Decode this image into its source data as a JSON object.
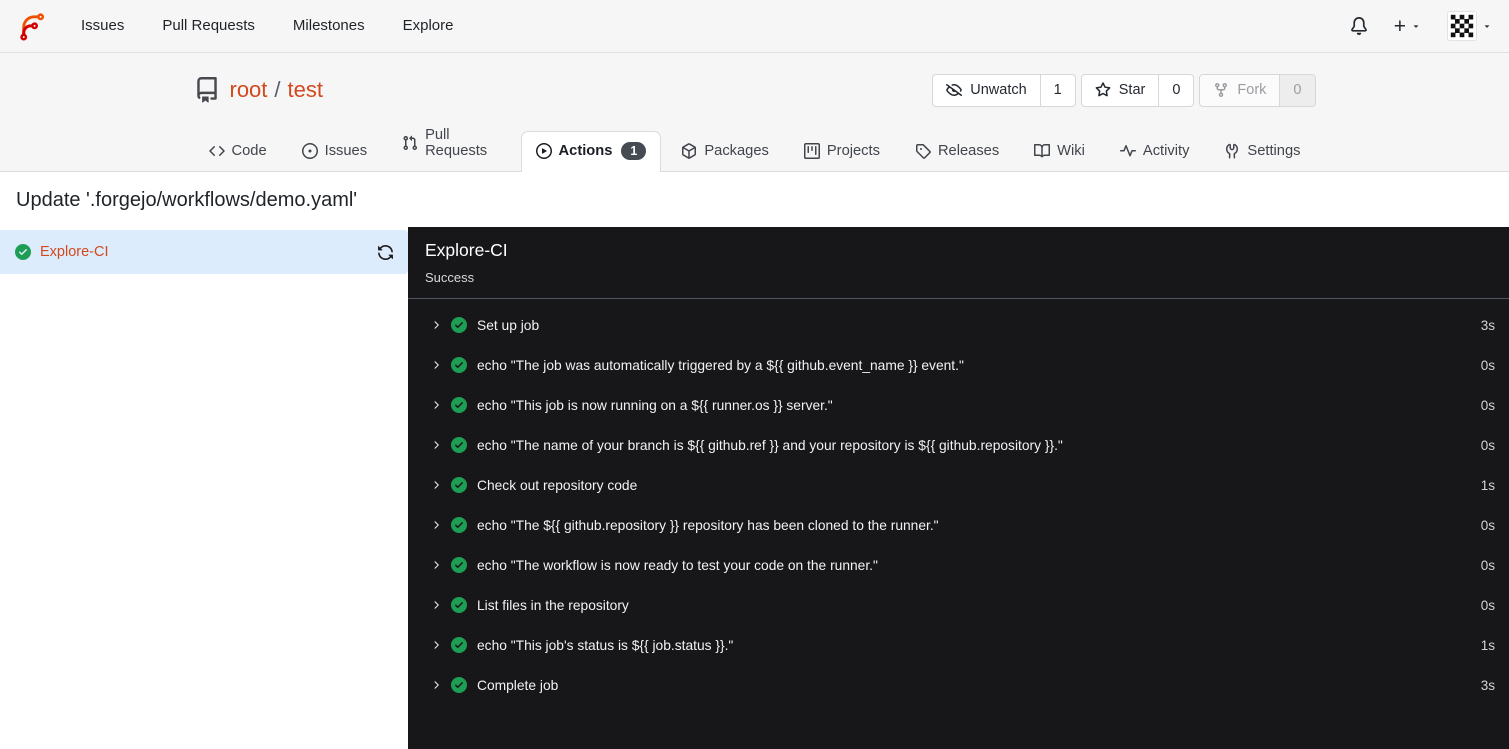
{
  "navbar": {
    "links": [
      {
        "label": "Issues"
      },
      {
        "label": "Pull Requests"
      },
      {
        "label": "Milestones"
      },
      {
        "label": "Explore"
      }
    ]
  },
  "repo_header": {
    "owner": "root",
    "separator": "/",
    "name": "test",
    "watch": {
      "label": "Unwatch",
      "count": "1"
    },
    "star": {
      "label": "Star",
      "count": "0"
    },
    "fork": {
      "label": "Fork",
      "count": "0"
    }
  },
  "tabs": {
    "code": "Code",
    "issues": "Issues",
    "pull_requests": "Pull Requests",
    "actions": "Actions",
    "actions_badge": "1",
    "packages": "Packages",
    "projects": "Projects",
    "releases": "Releases",
    "wiki": "Wiki",
    "activity": "Activity",
    "settings": "Settings"
  },
  "run": {
    "commit_title": "Update '.forgejo/workflows/demo.yaml'",
    "job_name": "Explore-CI",
    "job_status": "Success",
    "steps": [
      {
        "name": "Set up job",
        "duration": "3s"
      },
      {
        "name": "echo \"The job was automatically triggered by a ${{ github.event_name }} event.\"",
        "duration": "0s"
      },
      {
        "name": "echo \"This job is now running on a ${{ runner.os }} server.\"",
        "duration": "0s"
      },
      {
        "name": "echo \"The name of your branch is ${{ github.ref }} and your repository is ${{ github.repository }}.\"",
        "duration": "0s"
      },
      {
        "name": "Check out repository code",
        "duration": "1s"
      },
      {
        "name": "echo \"The ${{ github.repository }} repository has been cloned to the runner.\"",
        "duration": "0s"
      },
      {
        "name": "echo \"The workflow is now ready to test your code on the runner.\"",
        "duration": "0s"
      },
      {
        "name": "List files in the repository",
        "duration": "0s"
      },
      {
        "name": "echo \"This job's status is ${{ job.status }}.\"",
        "duration": "1s"
      },
      {
        "name": "Complete job",
        "duration": "3s"
      }
    ]
  },
  "colors": {
    "primary_orange": "#d2491f",
    "success_green": "#1e9e55",
    "selected_job_bg": "#dcecfc",
    "panel_dark_bg": "#17171a",
    "badge_bg": "#464a52"
  }
}
